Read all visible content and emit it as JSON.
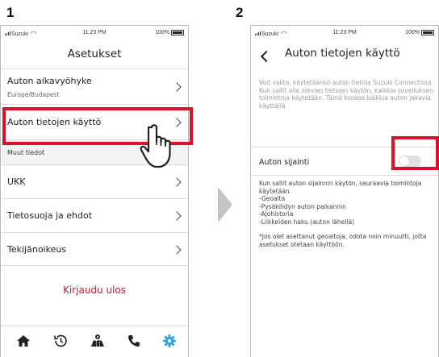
{
  "steps": [
    "1",
    "2"
  ],
  "status": {
    "carrier": "Suzuki",
    "time": "11:23 PM",
    "battery": "100%"
  },
  "screen1": {
    "title": "Asetukset",
    "items": [
      {
        "label": "Auton aikavyöhyke",
        "sub": "Europe/Budapest"
      },
      {
        "label": "Auton tietojen käyttö"
      }
    ],
    "section": "Muut tiedot",
    "more_items": [
      "UKK",
      "Tietosuoja ja ehdot",
      "Tekijänoikeus"
    ],
    "logout": "Kirjaudu ulos",
    "tabs": [
      "home-icon",
      "history-icon",
      "map-icon",
      "phone-icon",
      "gear-icon"
    ],
    "accent": "#d8112d",
    "active_tab_color": "#2aa6df"
  },
  "screen2": {
    "title": "Auton tietojen käyttö",
    "description": "Voit valita, käytetäänkö auton tietoja Suzuki Connectissa. Kun sallit alla olevien tietojen käytön, kaikkia sovelluksen toimintoja käytetään. Tämä koskee kaikkia auton jakavia käyttäjiä.",
    "toggle_label": "Auton sijainti",
    "toggle_on": false,
    "info_intro": "Kun sallit auton sijainnin käytön, seuraavia toimintoja käytetään.",
    "info_items": [
      "-Geoaita",
      "-Pysäköidyn auton paikannin",
      "-Ajohistoria",
      "-Liikkeiden haku (auton lähellä)"
    ],
    "note": "*Jos olet asettanut geoaitoja, odota noin minuutti, jotta asetukset otetaan käyttöön."
  }
}
